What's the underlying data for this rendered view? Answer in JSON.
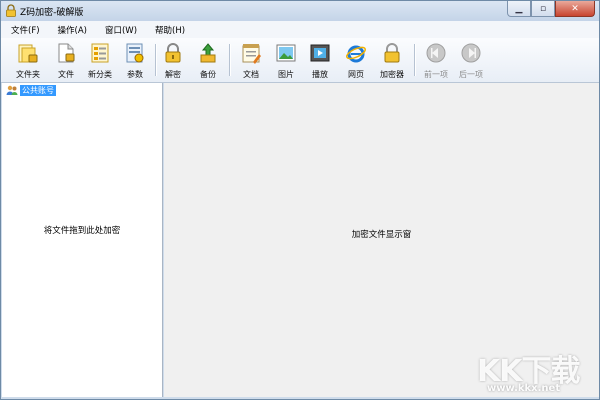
{
  "window": {
    "title": "Z码加密-破解版"
  },
  "menu": [
    "文件(F)",
    "操作(A)",
    "窗口(W)",
    "帮助(H)"
  ],
  "toolbar": {
    "folder": "文件夹",
    "file": "文件",
    "new_category": "新分类",
    "params": "参数",
    "decrypt": "解密",
    "backup": "备份",
    "document": "文档",
    "picture": "图片",
    "play": "播放",
    "webpage": "网页",
    "encryptor": "加密器",
    "previous": "前一项",
    "next": "后一项"
  },
  "tree": {
    "root": "公共账号"
  },
  "left_pane": {
    "hint": "将文件拖到此处加密"
  },
  "right_pane": {
    "hint": "加密文件显示窗"
  },
  "watermark": {
    "logo": "KK下载",
    "url": "www.kkx.net"
  }
}
